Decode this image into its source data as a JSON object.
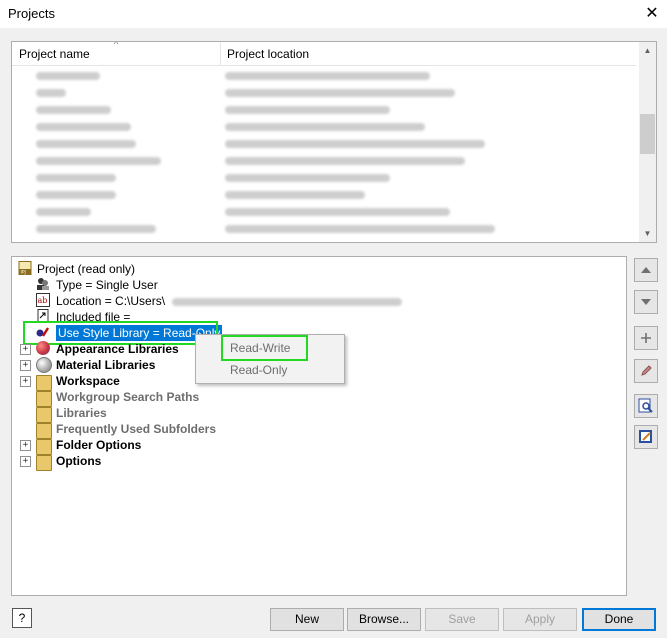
{
  "window": {
    "title": "Projects",
    "close_glyph": "✕"
  },
  "project_list": {
    "columns": [
      "Project name",
      "Project location"
    ],
    "sort_indicator": "^",
    "row_count": 10
  },
  "tree": {
    "root": {
      "label": "Project (read only)",
      "icon": "ipj-file-icon"
    },
    "type": {
      "label": "Type = Single User",
      "icon": "users-icon"
    },
    "location": {
      "label": "Location = C:\\Users\\",
      "icon": "text-field-icon"
    },
    "included": {
      "label": "Included file =",
      "icon": "link-file-icon"
    },
    "style_library": {
      "label": "Use Style Library = Read-Only",
      "icon": "style-icon"
    },
    "groups": [
      {
        "label": "Appearance Libraries",
        "icon": "appearance-globe-icon",
        "expandable": true,
        "enabled": true
      },
      {
        "label": "Material Libraries",
        "icon": "material-sphere-icon",
        "expandable": true,
        "enabled": true
      },
      {
        "label": "Workspace",
        "icon": "folder-icon",
        "expandable": true,
        "enabled": true
      },
      {
        "label": "Workgroup Search Paths",
        "icon": "folder-icon",
        "expandable": false,
        "enabled": false
      },
      {
        "label": "Libraries",
        "icon": "folder-icon",
        "expandable": false,
        "enabled": false
      },
      {
        "label": "Frequently Used Subfolders",
        "icon": "folder-icon",
        "expandable": false,
        "enabled": false
      },
      {
        "label": "Folder Options",
        "icon": "folder-icon",
        "expandable": true,
        "enabled": true
      },
      {
        "label": "Options",
        "icon": "folder-icon",
        "expandable": true,
        "enabled": true
      }
    ]
  },
  "context_menu": {
    "items": [
      "Read-Write",
      "Read-Only"
    ]
  },
  "side_tools": [
    "move-up-icon",
    "move-down-icon",
    "add-icon",
    "edit-icon",
    "find-icon",
    "edit-project-icon"
  ],
  "buttons": {
    "help": "?",
    "new": "New",
    "browse": "Browse...",
    "save": "Save",
    "apply": "Apply",
    "done": "Done"
  },
  "colors": {
    "selection": "#0078d7",
    "highlight_box": "#22d922"
  }
}
